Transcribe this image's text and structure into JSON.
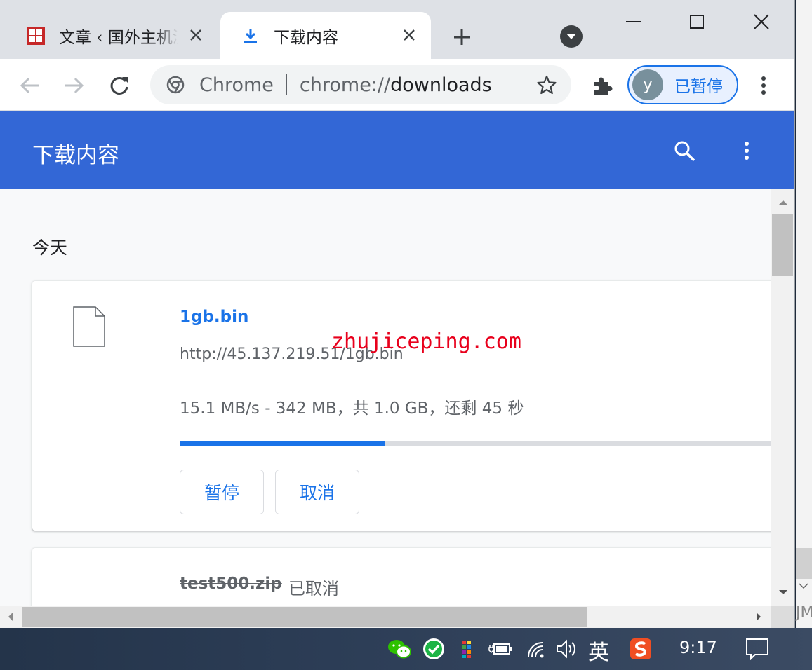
{
  "tabs": [
    {
      "title": "文章 ‹ 国外主机测评",
      "favicon": "site-logo-icon"
    },
    {
      "title": "下载内容",
      "favicon": "download-icon",
      "active": true
    }
  ],
  "toolbar": {
    "omnibox_chip": "Chrome",
    "url_scheme": "chrome://",
    "url_host": "downloads",
    "avatar_letter": "y",
    "profile_label": "已暂停"
  },
  "page": {
    "header_title": "下载内容",
    "date_label": "今天"
  },
  "downloads": [
    {
      "file_name": "1gb.bin",
      "url": "http://45.137.219.51/1gb.bin",
      "status": "15.1 MB/s - 342 MB，共 1.0 GB，还剩 45 秒",
      "progress_percent": 34,
      "pause_label": "暂停",
      "cancel_label": "取消"
    },
    {
      "file_name": "test500.zip",
      "status": "已取消"
    }
  ],
  "watermark": "zhujiceping.com",
  "background_strip": {
    "text": "JM"
  },
  "taskbar": {
    "ime": "英",
    "clock": "9:17"
  },
  "colors": {
    "accent": "#1a73e8",
    "header": "#3367d6"
  }
}
